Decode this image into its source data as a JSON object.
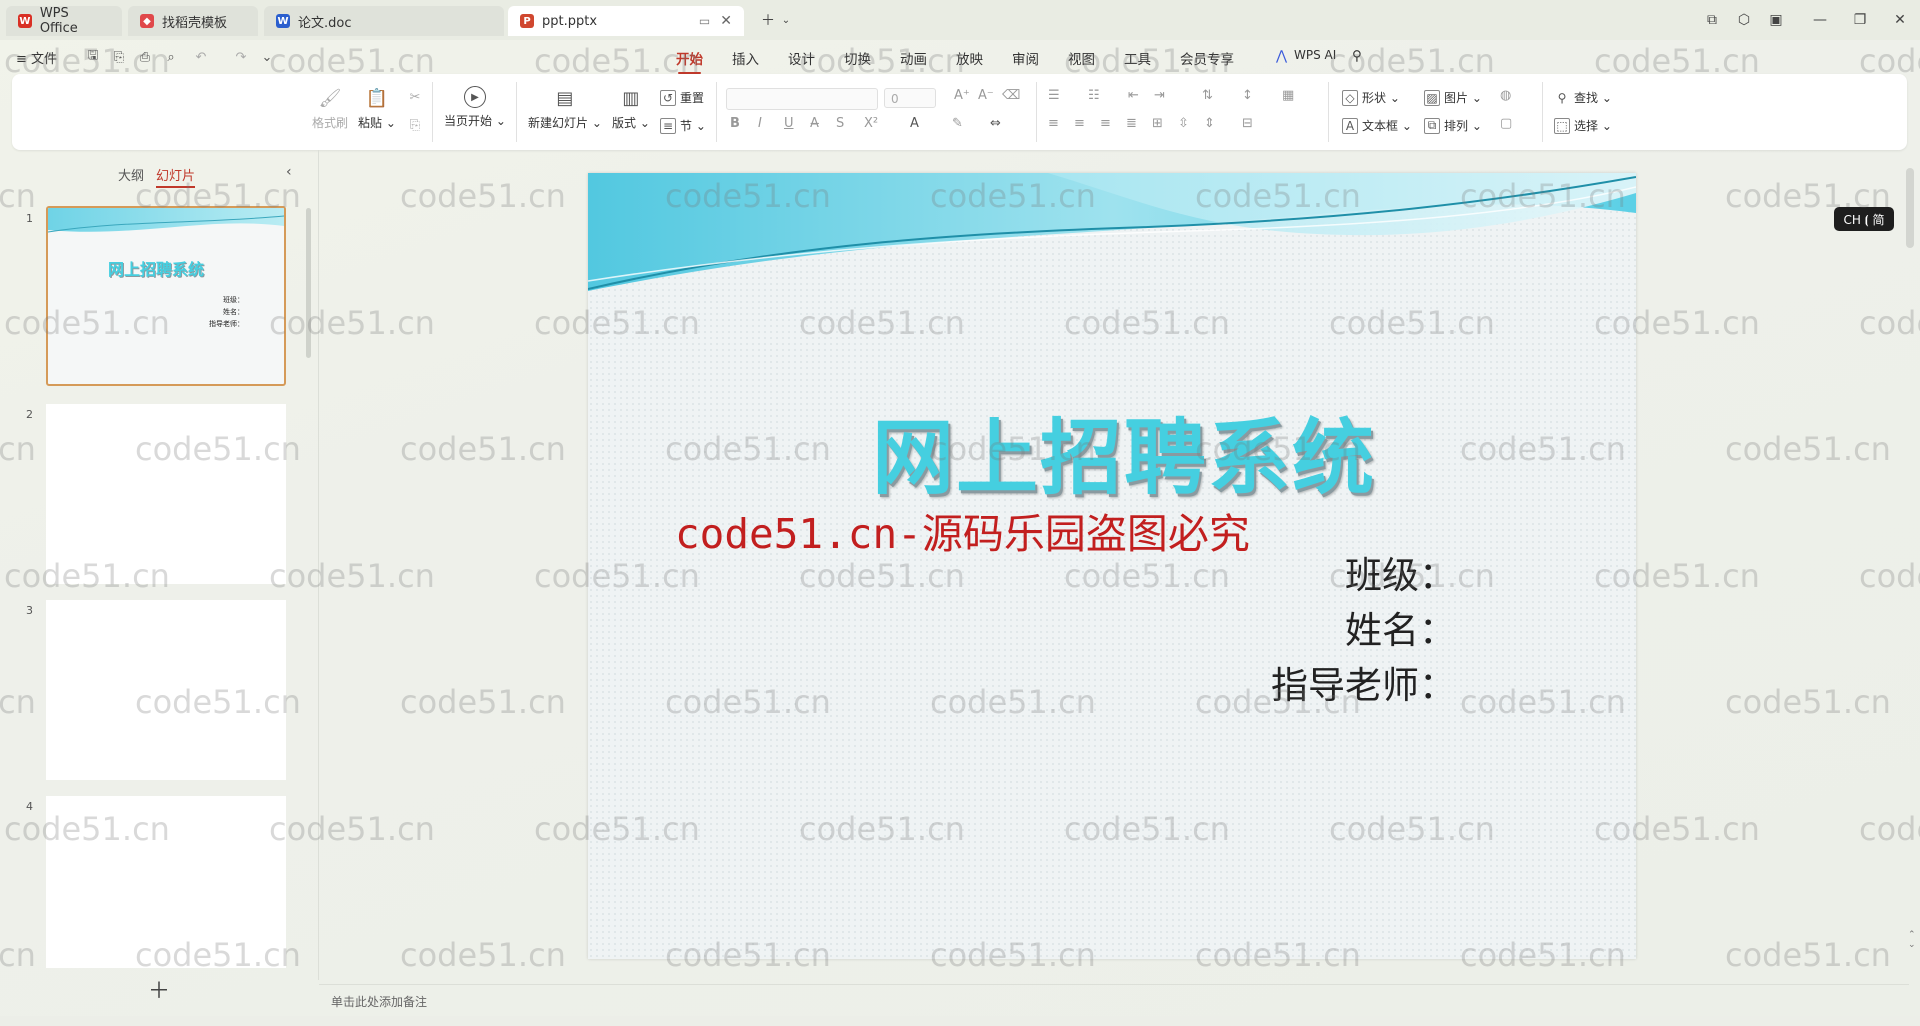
{
  "tabs": [
    {
      "label": "WPS Office",
      "icon": "wps-logo-icon",
      "color": "#d93025"
    },
    {
      "label": "找稻壳模板",
      "icon": "docer-icon",
      "color": "#e0484a"
    },
    {
      "label": "论文.doc",
      "icon": "word-doc-icon",
      "color": "#2b5fce"
    },
    {
      "label": "ppt.pptx",
      "icon": "ppt-icon",
      "color": "#d0472f"
    }
  ],
  "menu": {
    "file": "≡ 文件",
    "ribbon_tabs": [
      "开始",
      "插入",
      "设计",
      "切换",
      "动画",
      "放映",
      "审阅",
      "视图",
      "工具",
      "会员专享"
    ],
    "ai": "WPS AI"
  },
  "ribbon": {
    "format_painter": "格式刷",
    "paste": "粘贴",
    "from_start": "当页开始",
    "new_slide": "新建幻灯片",
    "layout": "版式",
    "reset": "重置",
    "section": "节",
    "font_size": "0",
    "shape": "形状",
    "picture": "图片",
    "find": "查找",
    "textbox": "文本框",
    "arrange": "排列",
    "select": "选择"
  },
  "panel": {
    "tab_outline": "大纲",
    "tab_slides": "幻灯片",
    "slide_numbers": [
      "1",
      "2",
      "3",
      "4"
    ],
    "thumb_title": "网上招聘系统",
    "thumb_lines": [
      "班级：",
      "姓名：",
      "指导老师："
    ]
  },
  "slide": {
    "title": "网上招聘系统",
    "watermark": "code51.cn-源码乐园盗图必究",
    "lines": [
      "班级：",
      "姓名：",
      "指导老师："
    ]
  },
  "ime": "CH ⦗ 简",
  "notes_placeholder": "单击此处添加备注",
  "watermark_text": "code51.cn"
}
